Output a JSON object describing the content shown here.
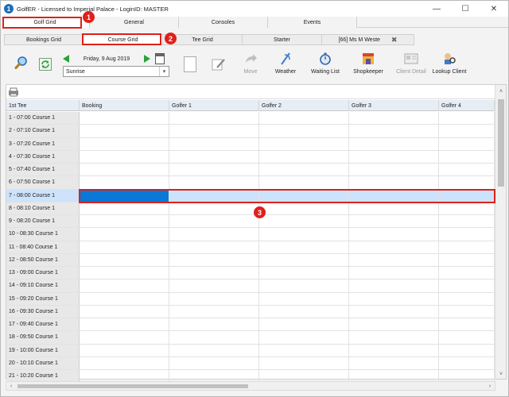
{
  "window": {
    "title": "GolfER - Licensed to Imperial Palace - LoginID: MASTER",
    "min": "—",
    "max": "☐",
    "close": "✕"
  },
  "top_tabs": [
    "Golf Grid",
    "General",
    "Consoles",
    "Events"
  ],
  "sub_tabs": [
    "Bookings Grid",
    "Course Grid",
    "Tee Grid",
    "Starter",
    "[66] Ms M Weste"
  ],
  "sub_tab_close": "✖",
  "toolbar": {
    "date": "Friday, 9 Aug 2019",
    "session": "Sunrise",
    "buttons": [
      "Move",
      "Weather",
      "Waiting List",
      "Shopkeeper",
      "Client Detail",
      "Lookup Client"
    ]
  },
  "grid": {
    "columns": [
      "1st Tee",
      "Booking",
      "Golfer 1",
      "Golfer 2",
      "Golfer 3",
      "Golfer 4"
    ],
    "rows": [
      "1 - 07:00  Course 1",
      "2 - 07:10  Course 1",
      "3 - 07:20  Course 1",
      "4 - 07:30  Course 1",
      "5 - 07:40  Course 1",
      "6 - 07:50  Course 1",
      "7 - 08:00  Course 1",
      "8 - 08:10  Course 1",
      "9 - 08:20  Course 1",
      "10 - 08:30  Course 1",
      "11 - 08:40  Course 1",
      "12 - 08:50  Course 1",
      "13 - 09:00  Course 1",
      "14 - 09:10  Course 1",
      "15 - 09:20  Course 1",
      "16 - 09:30  Course 1",
      "17 - 09:40  Course 1",
      "18 - 09:50  Course 1",
      "19 - 10:00  Course 1",
      "20 - 10:10  Course 1",
      "21 - 10:20  Course 1"
    ],
    "selected_row": 6
  },
  "annotations": [
    "1",
    "2",
    "3"
  ],
  "colors": {
    "highlight": "#e0201a",
    "selection": "#0a78d6",
    "selection_row": "#cde3fb",
    "header": "#e7edf5"
  }
}
